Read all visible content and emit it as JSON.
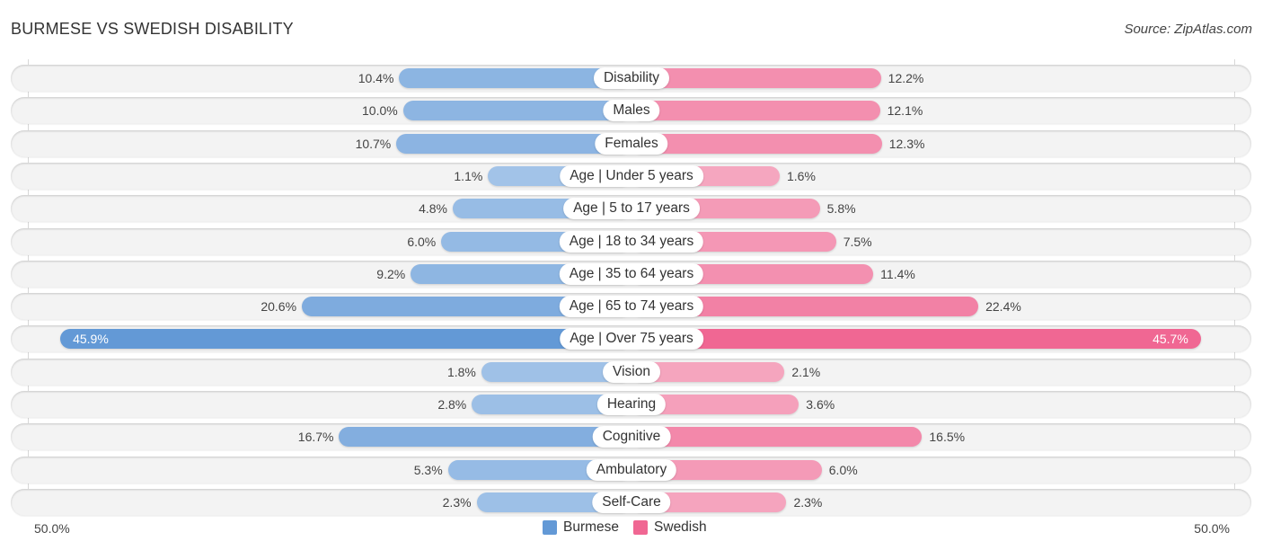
{
  "header": {
    "title": "BURMESE VS SWEDISH DISABILITY",
    "source": "Source: ZipAtlas.com"
  },
  "colors": {
    "burmese_light": "#a9c8ea",
    "burmese_dark": "#6399d6",
    "swedish_light": "#f6b0c6",
    "swedish_dark": "#f06793"
  },
  "chart_data": {
    "type": "bar",
    "orientation": "horizontal-diverging",
    "title": "BURMESE VS SWEDISH DISABILITY",
    "categories": [
      "Disability",
      "Males",
      "Females",
      "Age | Under 5 years",
      "Age | 5 to 17 years",
      "Age | 18 to 34 years",
      "Age | 35 to 64 years",
      "Age | 65 to 74 years",
      "Age | Over 75 years",
      "Vision",
      "Hearing",
      "Cognitive",
      "Ambulatory",
      "Self-Care"
    ],
    "series": [
      {
        "name": "Burmese",
        "color": "#6399d6",
        "values": [
          10.4,
          10.0,
          10.7,
          1.1,
          4.8,
          6.0,
          9.2,
          20.6,
          45.9,
          1.8,
          2.8,
          16.7,
          5.3,
          2.3
        ],
        "labels": [
          "10.4%",
          "10.0%",
          "10.7%",
          "1.1%",
          "4.8%",
          "6.0%",
          "9.2%",
          "20.6%",
          "45.9%",
          "1.8%",
          "2.8%",
          "16.7%",
          "5.3%",
          "2.3%"
        ]
      },
      {
        "name": "Swedish",
        "color": "#f06793",
        "values": [
          12.2,
          12.1,
          12.3,
          1.6,
          5.8,
          7.5,
          11.4,
          22.4,
          45.7,
          2.1,
          3.6,
          16.5,
          6.0,
          2.3
        ],
        "labels": [
          "12.2%",
          "12.1%",
          "12.3%",
          "1.6%",
          "5.8%",
          "7.5%",
          "11.4%",
          "22.4%",
          "45.7%",
          "2.1%",
          "3.6%",
          "16.5%",
          "6.0%",
          "2.3%"
        ]
      }
    ],
    "xlim": [
      -50,
      50
    ],
    "axis_labels": {
      "left": "50.0%",
      "right": "50.0%"
    },
    "legend": {
      "position": "bottom-center",
      "entries": [
        "Burmese",
        "Swedish"
      ]
    },
    "grid": false
  }
}
